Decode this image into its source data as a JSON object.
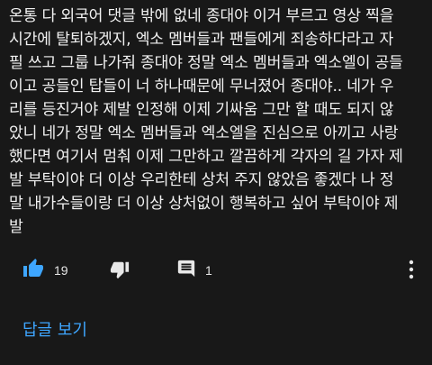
{
  "comment": {
    "text": "온통 다 외국어 댓글 밖에 없네 종대야 이거 부르고 영상 찍을\n시간에 탈퇴하겠지, 엑소 멤버들과 팬들에게 죄송하다라고 자\n필 쓰고 그룹 나가줘 종대야 정말 엑소 멤버들과 엑소엘이 공들\n이고 공들인 탑들이 너 하나때문에 무너졌어 종대야.. 네가 우\n리를 등진거야 제발 인정해 이제 기싸움 그만 할 때도 되지 않\n았니 네가 정말 엑소 멤버들과 엑소엘을 진심으로 아끼고 사랑\n했다면 여기서 멈춰 이제 그만하고 깔끔하게 각자의 길 가자 제\n발 부탁이야 더 이상 우리한테 상처 주지 않았음 좋겠다 나 정\n말 내가수들이랑 더 이상 상처없이 행복하고 싶어 부탁이야 제\n발"
  },
  "actions": {
    "like_icon": "thumbs-up-filled",
    "like_count": "19",
    "dislike_icon": "thumbs-down-filled",
    "reply_icon": "comment-filled",
    "reply_count": "1",
    "more_icon": "more-vertical"
  },
  "view_replies_label": "답글 보기",
  "colors": {
    "background": "#181818",
    "text": "#f1f1f1",
    "accent": "#3ea6ff",
    "active_icon": "#3ea6ff",
    "icon": "#e8e8e8"
  }
}
